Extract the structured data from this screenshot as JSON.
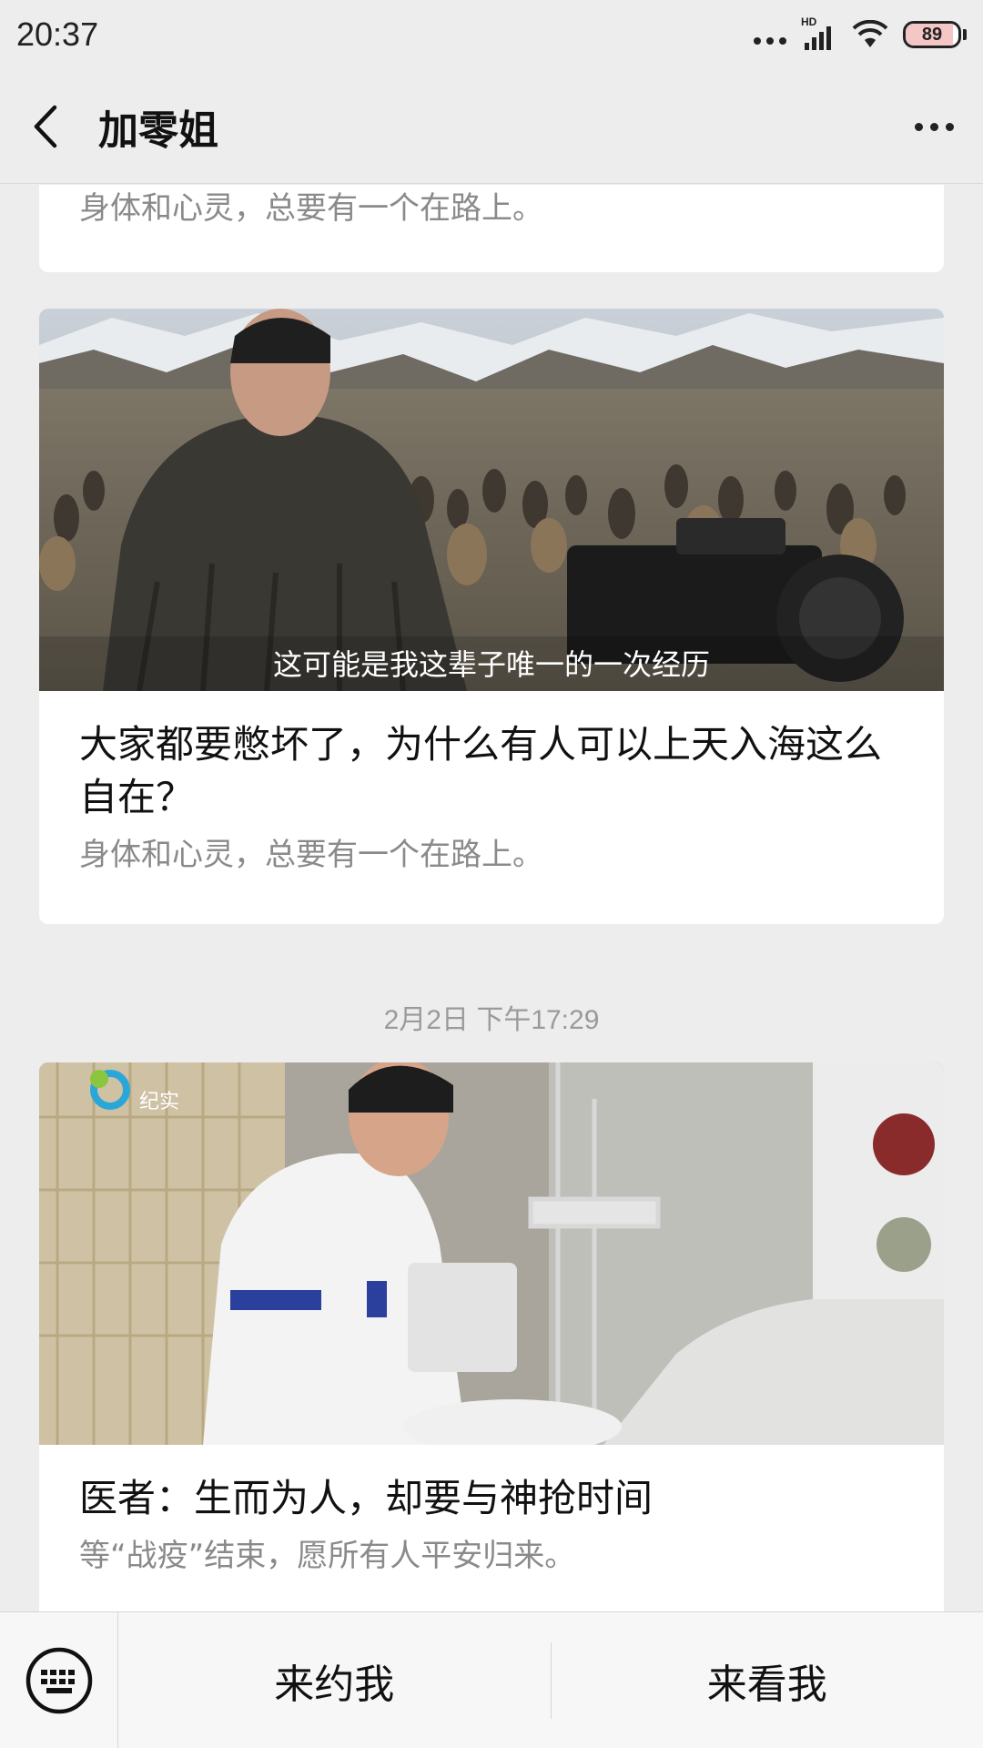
{
  "status_bar": {
    "time": "20:37",
    "hd_label": "HD",
    "battery_level": "89",
    "battery_fill_fraction": 0.89
  },
  "header": {
    "title": "加零姐",
    "back_icon": "chevron-left-icon",
    "more_icon": "more-dots-icon"
  },
  "feed": {
    "top_card": {
      "subtitle": "身体和心灵，总要有一个在路上。"
    },
    "articles": [
      {
        "thumbnail_caption": "这可能是我这辈子唯一的一次经历",
        "title": "大家都要憋坏了，为什么有人可以上天入海这么自在？",
        "subtitle": "身体和心灵，总要有一个在路上。"
      },
      {
        "thumbnail_logo": "纪实",
        "title": "医者：生而为人，却要与神抢时间",
        "subtitle": "等“战疫”结束，愿所有人平安归来。"
      }
    ],
    "date_separator": "2月2日 下午17:29"
  },
  "bottom_bar": {
    "keyboard_icon": "keyboard-icon",
    "menu_1": "来约我",
    "menu_2": "来看我"
  },
  "colors": {
    "background": "#ededed",
    "card": "#ffffff",
    "secondary_text": "#8a8a8a"
  }
}
